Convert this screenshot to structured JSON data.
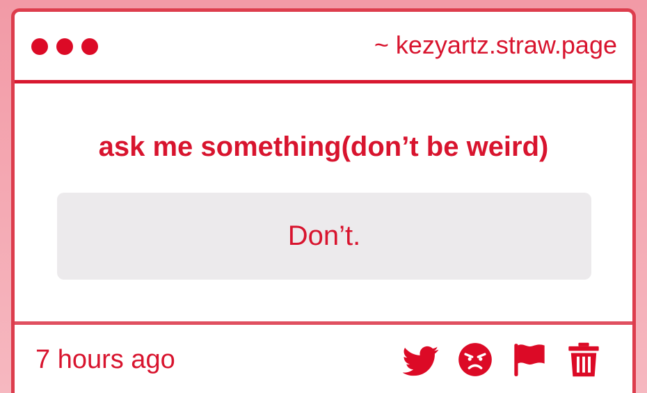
{
  "window": {
    "url": "~ kezyartz.straw.page"
  },
  "question": {
    "text": "ask me something(don’t be weird)"
  },
  "answer": {
    "text": "Don’t."
  },
  "footer": {
    "timestamp": "7 hours ago",
    "actions": [
      {
        "icon": "twitter-icon"
      },
      {
        "icon": "angry-face-icon"
      },
      {
        "icon": "flag-icon"
      },
      {
        "icon": "trash-icon"
      }
    ]
  },
  "colors": {
    "accent": "#d8142e",
    "background": "#f29aa6",
    "answer_bg": "#eceaec"
  }
}
